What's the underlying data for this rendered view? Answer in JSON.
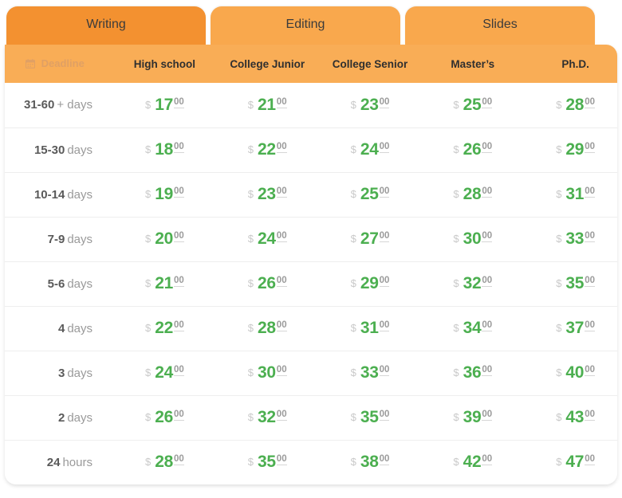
{
  "tabs": [
    {
      "label": "Writing",
      "active": true
    },
    {
      "label": "Editing",
      "active": false
    },
    {
      "label": "Slides",
      "active": false
    }
  ],
  "colors": {
    "tab_active": "#f39130",
    "tab_inactive": "#f9a84d",
    "header_bg": "#f9ad56",
    "price_green": "#4caf50",
    "currency_gray": "#c9c9c9",
    "cents_gray": "#9b9b9b",
    "deadline_num": "#5a5a5a",
    "deadline_unit": "#9a9a9a",
    "row_divider": "#eeeeee"
  },
  "table": {
    "deadline_header": "Deadline",
    "deadline_icon": "calendar-icon",
    "currency_symbol": "$",
    "cents": "00",
    "columns": [
      "High school",
      "College Junior",
      "College Senior",
      "Master’s",
      "Ph.D."
    ],
    "rows": [
      {
        "deadline_num": "31-60",
        "deadline_unit": "+ days",
        "prices": [
          "17",
          "21",
          "23",
          "25",
          "28"
        ]
      },
      {
        "deadline_num": "15-30",
        "deadline_unit": "days",
        "prices": [
          "18",
          "22",
          "24",
          "26",
          "29"
        ]
      },
      {
        "deadline_num": "10-14",
        "deadline_unit": "days",
        "prices": [
          "19",
          "23",
          "25",
          "28",
          "31"
        ]
      },
      {
        "deadline_num": "7-9",
        "deadline_unit": "days",
        "prices": [
          "20",
          "24",
          "27",
          "30",
          "33"
        ]
      },
      {
        "deadline_num": "5-6",
        "deadline_unit": "days",
        "prices": [
          "21",
          "26",
          "29",
          "32",
          "35"
        ]
      },
      {
        "deadline_num": "4",
        "deadline_unit": "days",
        "prices": [
          "22",
          "28",
          "31",
          "34",
          "37"
        ]
      },
      {
        "deadline_num": "3",
        "deadline_unit": "days",
        "prices": [
          "24",
          "30",
          "33",
          "36",
          "40"
        ]
      },
      {
        "deadline_num": "2",
        "deadline_unit": "days",
        "prices": [
          "26",
          "32",
          "35",
          "39",
          "43"
        ]
      },
      {
        "deadline_num": "24",
        "deadline_unit": "hours",
        "prices": [
          "28",
          "35",
          "38",
          "42",
          "47"
        ]
      }
    ]
  }
}
